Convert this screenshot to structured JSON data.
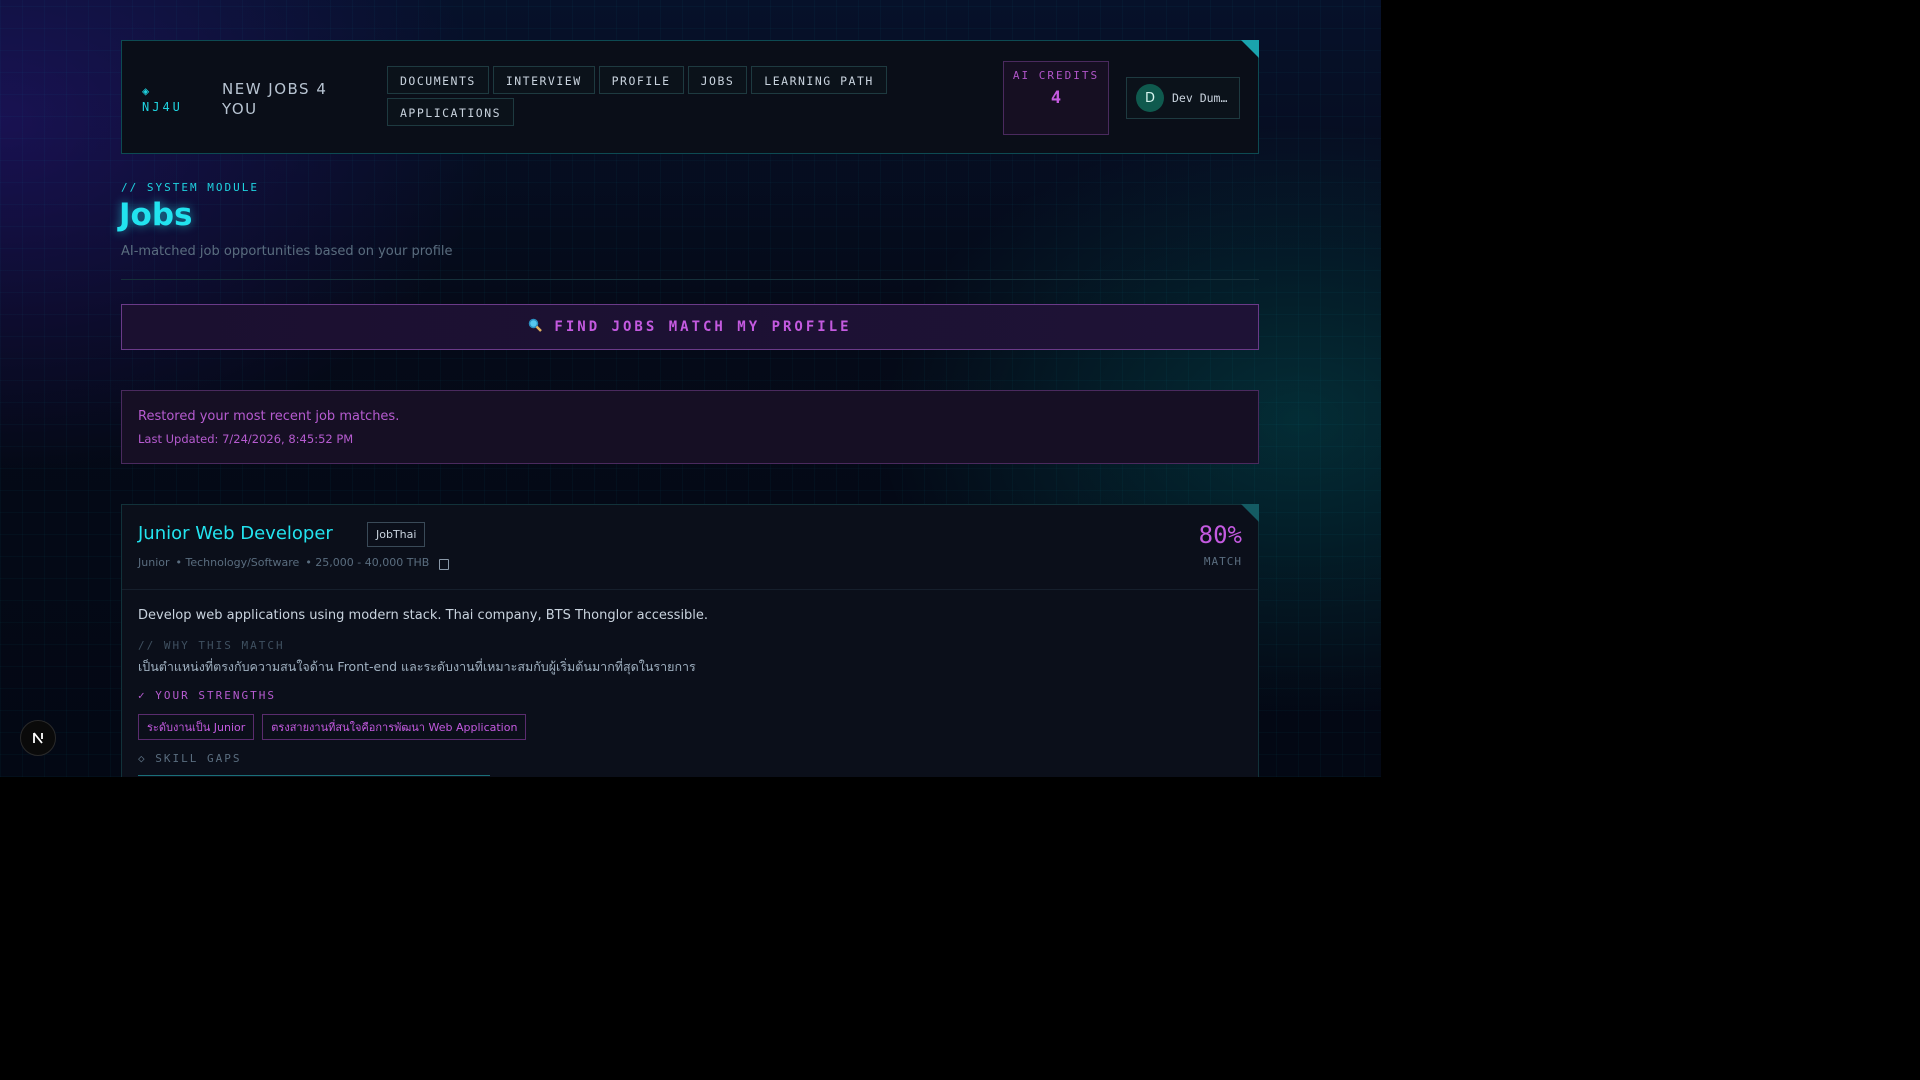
{
  "header": {
    "brand_mark": "◈ NJ4U",
    "brand_name": "NEW JOBS 4 YOU",
    "nav": [
      "DOCUMENTS",
      "INTERVIEW",
      "PROFILE",
      "JOBS",
      "LEARNING PATH",
      "APPLICATIONS"
    ],
    "credits_label": "AI CREDITS",
    "credits_value": "4",
    "user_initial": "D",
    "user_name": "Dev Dum…"
  },
  "page": {
    "kicker": "// SYSTEM MODULE",
    "title": "Jobs",
    "subtitle": "AI-matched job opportunities based on your profile"
  },
  "find_button": {
    "icon": "magnifier-icon",
    "label": "FIND JOBS MATCH MY PROFILE"
  },
  "notice": {
    "message": "Restored your most recent job matches.",
    "last_updated": "Last Updated: 7/24/2026, 8:45:52 PM"
  },
  "job": {
    "title": "Junior Web Developer",
    "source": "JobThai",
    "level": "Junior",
    "industry": "• Technology/Software",
    "salary": "• 25,000 - 40,000 THB",
    "match": "80%",
    "match_label": "MATCH",
    "description": "Develop web applications using modern stack. Thai company, BTS Thonglor accessible.",
    "why_label": "// WHY THIS MATCH",
    "why_text": "เป็นตำแหน่งที่ตรงกับความสนใจด้าน Front-end และระดับงานที่เหมาะสมกับผู้เริ่มต้นมากที่สุดในรายการ",
    "strengths_label": "✓ YOUR STRENGTHS",
    "strengths": [
      "ระดับงานเป็น Junior",
      "ตรงสายงานที่สนใจคือการพัฒนา Web Application"
    ],
    "gaps_label": "◇ SKILL GAPS"
  },
  "colors": {
    "cyan": "#22e3ef",
    "magenta": "#c45ae0",
    "panel": "#0a0e18"
  }
}
